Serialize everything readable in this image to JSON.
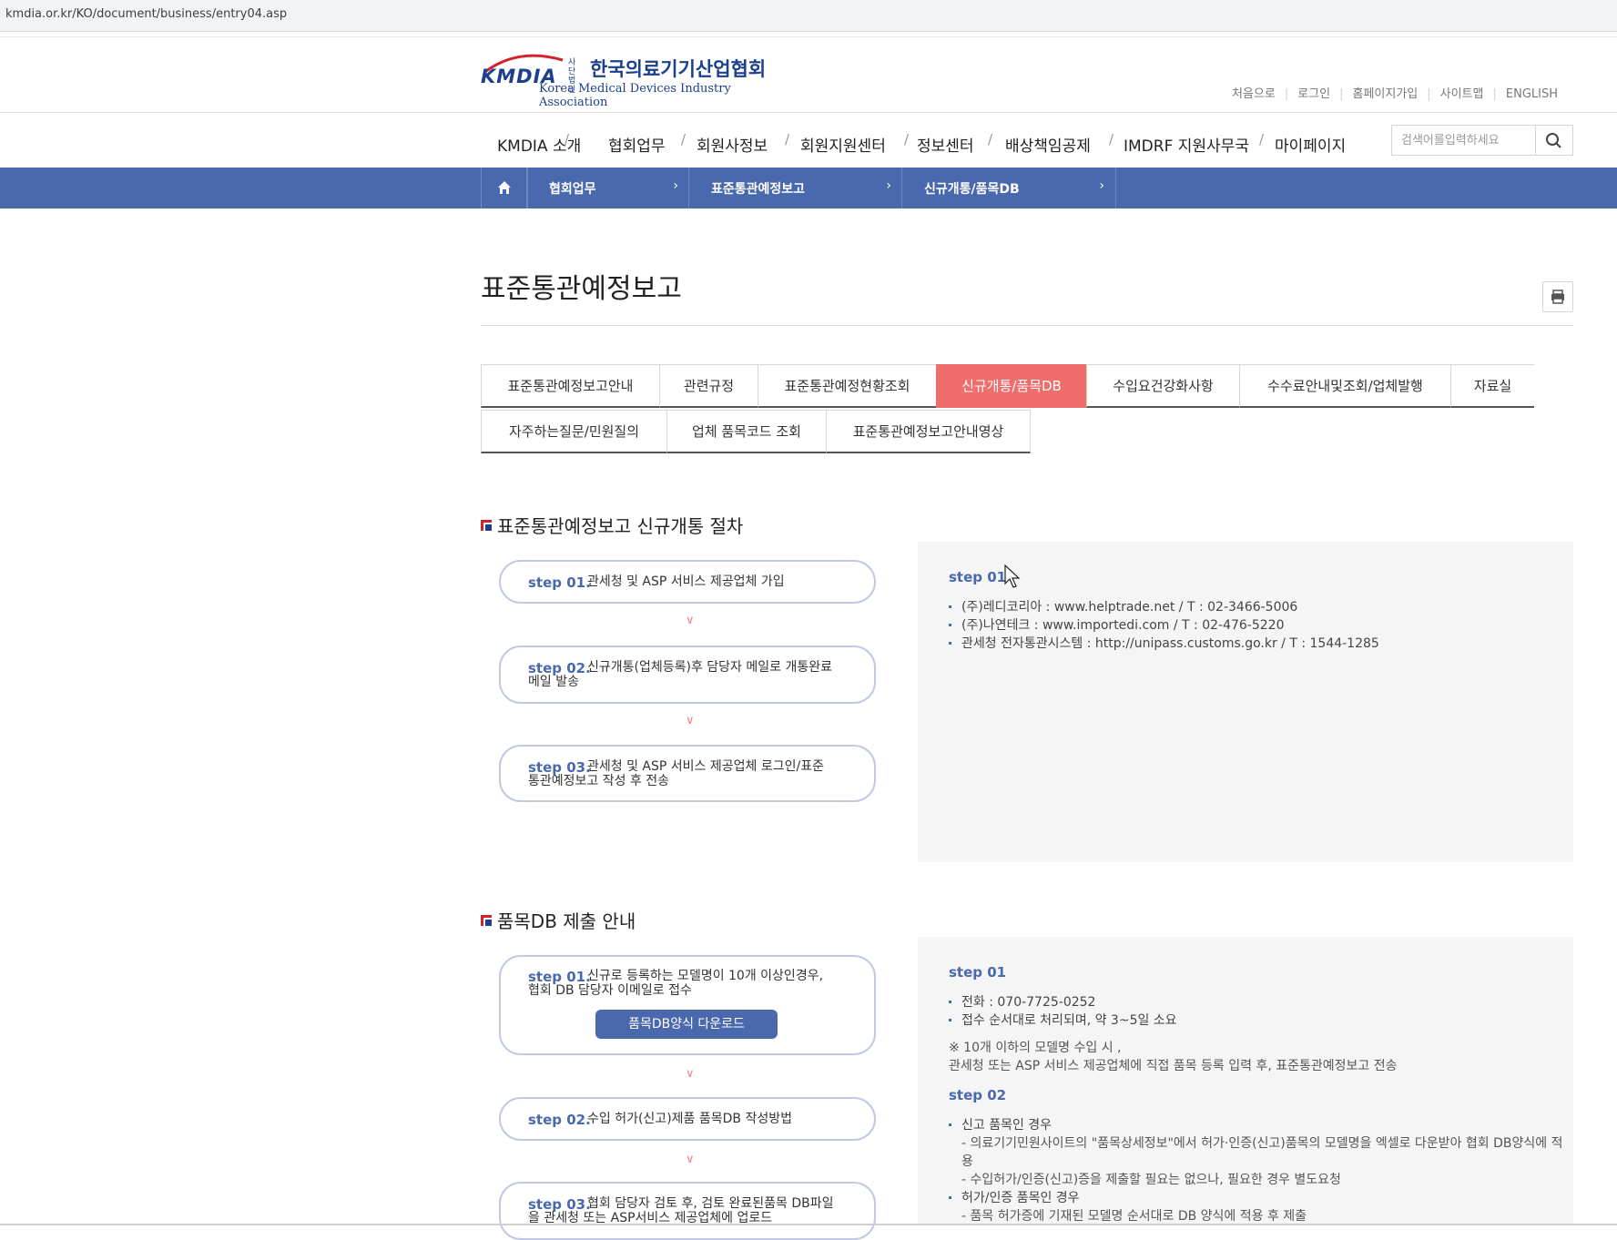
{
  "browser": {
    "url": "kmdia.or.kr/KO/document/business/entry04.asp"
  },
  "logo": {
    "abbr": "KMDIA",
    "corp": "사단법인",
    "name_ko": "한국의료기기산업협회",
    "name_en": "Korea Medical Devices Industry Association"
  },
  "util_links": [
    "처음으로",
    "로그인",
    "홈페이지가입",
    "사이트맵",
    "ENGLISH"
  ],
  "gnb": [
    "KMDIA 소개",
    "협회업무",
    "회원사정보",
    "회원지원센터",
    "정보센터",
    "배상책임공제",
    "IMDRF 지원사무국",
    "마이페이지"
  ],
  "gnb_sep": "/",
  "search": {
    "placeholder": "검색어를입력하세요"
  },
  "breadcrumb": [
    "협회업무",
    "표준통관예정보고",
    "신규개통/품목DB"
  ],
  "breadcrumb_arrow": "›",
  "page_title": "표준통관예정보고",
  "tabs_row1": [
    "표준통관예정보고안내",
    "관련규정",
    "표준통관예정현황조회",
    "신규개통/품목DB",
    "수입요건강화사항",
    "수수료안내및조회/업체발행",
    "자료실"
  ],
  "tabs_row2": [
    "자주하는질문/민원질의",
    "업체 품목코드 조회",
    "표준통관예정보고안내영상"
  ],
  "active_tab": "신규개통/품목DB",
  "chevron": "∨",
  "section1": {
    "title": "표준통관예정보고 신규개통 절차",
    "steps": [
      {
        "label": "step 01.",
        "line1": "관세청 및 ASP 서비스 제공업체 가입",
        "line2": ""
      },
      {
        "label": "step 02.",
        "line1": "신규개통(업체등록)후 담당자 메일로 개통완료",
        "line2": "메일 발송"
      },
      {
        "label": "step 03.",
        "line1": "관세청 및 ASP 서비스 제공업체 로그인/표준",
        "line2": "통관예정보고 작성 후 전송"
      }
    ],
    "panel": {
      "step_title": "step 01",
      "items": [
        "(주)레디코리아 : www.helptrade.net / T : 02-3466-5006",
        "(주)나연테크 : www.importedi.com / T : 02-476-5220",
        "관세청 전자통관시스템 : http://unipass.customs.go.kr / T : 1544-1285"
      ]
    }
  },
  "section2": {
    "title": "품목DB 제출 안내",
    "steps": [
      {
        "label": "step 01.",
        "line1": "신규로 등록하는 모델명이 10개 이상인경우,",
        "line2": "협회 DB 담당자 이메일로 접수"
      },
      {
        "label": "step 02.",
        "line1": "수입 허가(신고)제품 품목DB 작성방법",
        "line2": ""
      },
      {
        "label": "step 03.",
        "line1": "협회 담당자 검토 후, 검토 완료된품목 DB파일",
        "line2": "을 관세청 또는 ASP서비스 제공업체에 업로드"
      }
    ],
    "download_button": "품목DB양식 다운로드",
    "panel": {
      "step1_title": "step 01",
      "step1_items": [
        "전화 : 070-7725-0252",
        "접수 순서대로 처리되며, 약 3~5일 소요"
      ],
      "note_line1": "※ 10개 이하의 모델명 수입 시 ,",
      "note_line2": "관세청 또는 ASP 서비스 제공업체에 직접 품목 등록 입력 후, 표준통관예정보고 전송",
      "step2_title": "step 02",
      "step2_item1": "신고 품목인 경우",
      "step2_item1_sub1": "- 의료기기민원사이트의 \"품목상세정보\"에서 허가·인증(신고)품목의 모델명을 엑셀로 다운받아 협회 DB양식에 적",
      "step2_item1_sub1b": "용",
      "step2_item1_sub2": "- 수입허가/인증(신고)증을 제출할 필요는 없으나, 필요한 경우 별도요청",
      "step2_item2": "허가/인증 품목인 경우",
      "step2_item2_sub1": "- 품목 허가증에 기재된 모델명 순서대로 DB 양식에 적용 후 제출"
    }
  }
}
